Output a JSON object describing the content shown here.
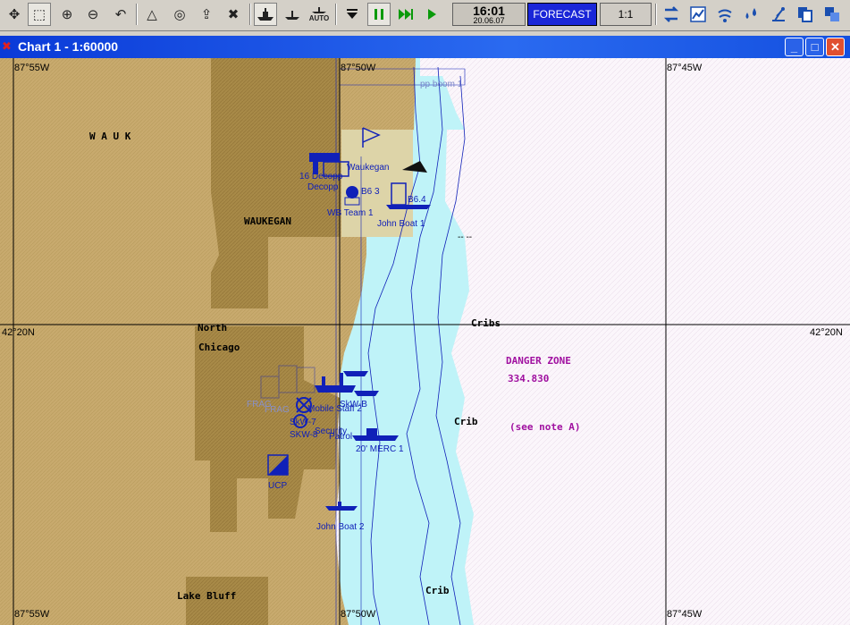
{
  "toolbar": {
    "tools": [
      {
        "name": "pan-icon",
        "glyph": "✥"
      },
      {
        "name": "select-icon",
        "glyph": "⬚"
      },
      {
        "name": "zoom-in-icon",
        "glyph": "⊕"
      },
      {
        "name": "zoom-out-icon",
        "glyph": "⊖"
      },
      {
        "name": "undo-icon",
        "glyph": "↶"
      },
      {
        "name": "compass-icon",
        "glyph": "△"
      },
      {
        "name": "target-icon",
        "glyph": "◎"
      },
      {
        "name": "export-icon",
        "glyph": "⇪"
      },
      {
        "name": "delete-icon",
        "glyph": "✖"
      }
    ],
    "time": "16:01",
    "date": "20.06.07",
    "forecast_label": "FORECAST",
    "scale_label": "1:1",
    "auto_label": "AUTO"
  },
  "window": {
    "title": "Chart 1 - 1:60000",
    "minimize": "_",
    "maximize": "□",
    "close": "✕"
  },
  "chart": {
    "colors": {
      "land": "#c8aa6e",
      "urban": "#a88a48",
      "shallow_water": "#bff3f8",
      "deep_water": "#fbf6fb",
      "unit_blue": "#1020b8",
      "danger_text": "#a010a0",
      "grid": "#000000"
    },
    "grid_labels": {
      "lon_55_top": "87°55W",
      "lon_50_top": "87°50W",
      "lon_45_top": "87°45W",
      "lon_55_bottom": "87°55W",
      "lon_50_bottom": "87°50W",
      "lon_45_bottom": "87°45W",
      "lat_left": "42°20N",
      "lat_right": "42°20N"
    },
    "place_labels": {
      "wauk": "W A U K",
      "waukegan": "WAUKEGAN",
      "north": "North",
      "chicago": "Chicago",
      "lake_bluff": "Lake Bluff",
      "cribs": "Cribs",
      "crib_mid": "Crib",
      "crib_low": "Crib",
      "danger_zone": "DANGER ZONE",
      "danger_freq": "334.830",
      "see_note": "(see note A)",
      "pp_boom": "pp boom 1",
      "dashes": "-- --"
    },
    "units": {
      "waukegan": "Waukegan",
      "decopp_top": "16 Decopp",
      "decopp": "Decopp",
      "b63": "B6 3",
      "b64": "B6.4",
      "wb_team": "WB Team 1",
      "john_boat_1": "John Boat 1",
      "mobile_staff": "Mobile Staff 2",
      "skw_b": "SkW-B",
      "skw_7": "SkW-7",
      "skw_8": "SKW-8",
      "security": "Security",
      "patrol": "Patrol",
      "merc": "20' MERC 1",
      "ucp": "UCP",
      "john_boat_2": "John Boat 2",
      "frag": "FRAG",
      "frag2": "FRAG"
    }
  }
}
